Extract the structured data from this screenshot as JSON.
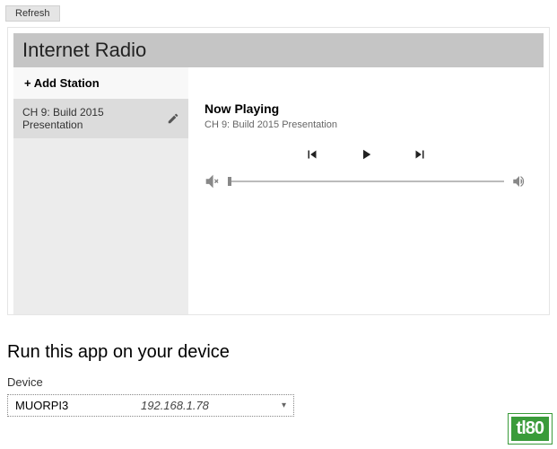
{
  "toolbar": {
    "refresh_label": "Refresh"
  },
  "app": {
    "title": "Internet Radio",
    "add_station_label": "+ Add Station",
    "stations": [
      {
        "label": "CH 9: Build 2015 Presentation"
      }
    ],
    "now_playing_label": "Now Playing",
    "now_playing_track": "CH 9: Build 2015 Presentation"
  },
  "deploy": {
    "heading": "Run this app on your device",
    "device_label": "Device",
    "selected_device_name": "MUORPI3",
    "selected_device_ip": "192.168.1.78"
  },
  "watermark": "tl80"
}
